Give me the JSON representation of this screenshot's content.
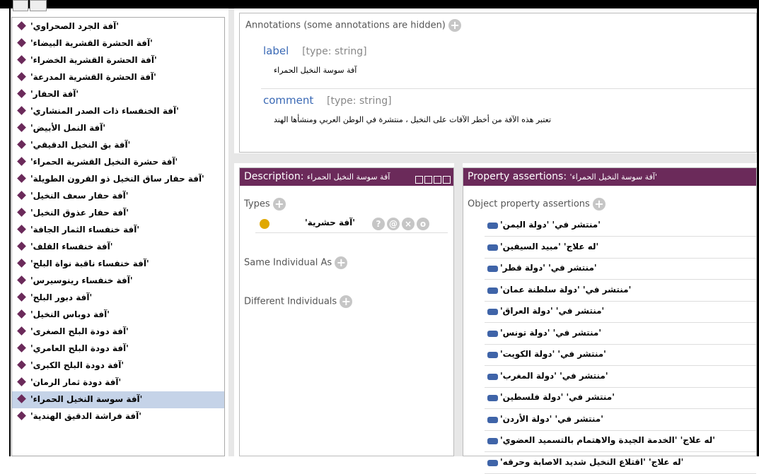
{
  "tree": {
    "items": [
      {
        "label": "'آفة الجرد الصحراوي'"
      },
      {
        "label": "'آفة الحشرة القشرية البيضاء'"
      },
      {
        "label": "'آفة الحشرة القشرية الخضراء'"
      },
      {
        "label": "'آفة الحشرة القشرية المدرعة'"
      },
      {
        "label": "'آفة الحفار'"
      },
      {
        "label": "'آفة الخنفساء ذات الصدر المنشاري'"
      },
      {
        "label": "'آفة النمل الأبيض'"
      },
      {
        "label": "'آفة بق النخيل الدقيقي'"
      },
      {
        "label": "'آفة حشرة النخيل القشرية الحمراء'"
      },
      {
        "label": "'آفة حفار ساق النخيل ذو القرون الطويلة'"
      },
      {
        "label": "'آفة حفار سعف النخيل'"
      },
      {
        "label": "'آفة حفار عذوق النخيل'"
      },
      {
        "label": "'آفة خنفساء الثمار الجافة'"
      },
      {
        "label": "'آفة خنفساء القلف'"
      },
      {
        "label": "'آفة خنفساء ناقبة نواة البلح'"
      },
      {
        "label": "'آفة خنفساء رينوسيرس'"
      },
      {
        "label": "'آفة دبور البلح'"
      },
      {
        "label": "'آفة دوباس النخيل'"
      },
      {
        "label": "'آفة دودة البلح الصغرى'"
      },
      {
        "label": "'آفة دودة البلح العامري'"
      },
      {
        "label": "'آفة دودة البلح الكبرى'"
      },
      {
        "label": "'آفة دودة ثمار الرمان'"
      },
      {
        "label": "'آفة سوسة النخيل الحمراء'",
        "selected": true
      },
      {
        "label": "'آفة فراشة الدقيق الهندية'"
      }
    ]
  },
  "annotations": {
    "title": "Annotations (some annotations are hidden)",
    "label_key": "label",
    "label_type": "[type: string]",
    "label_value": "آفة سوسة النخيل الحمراء",
    "comment_key": "comment",
    "comment_type": "[type: string]",
    "comment_value": "تعتبر هذه الآفة من أخطر الآفات على النخيل ، منتشرة في الوطن العربي ومنشأها الهند"
  },
  "description": {
    "header_prefix": "Description: ",
    "header_name": "آفة سوسة النخيل الحمراء",
    "types_title": "Types",
    "type_value": "'آفة حشرية'",
    "same_title": "Same Individual As",
    "different_title": "Different Individuals",
    "actions": [
      "?",
      "@",
      "×",
      "o"
    ]
  },
  "properties": {
    "header_prefix": "Property assertions: ",
    "header_name": "'آفة سوسة النخيل الحمراء'",
    "obj_title": "Object property assertions",
    "rows": [
      "'منتشر في' 'دولة اليمن'",
      "'له علاج' 'مبيد السيفين'",
      "'منتشر في' 'دولة قطر'",
      "'منتشر في' 'دولة سلطنة عمان'",
      "'منتشر في' 'دولة العراق'",
      "'منتشر في' 'دولة تونس'",
      "'منتشر في' 'دولة الكويت'",
      "'منتشر في' 'دولة المغرب'",
      "'منتشر في' 'دولة فلسطين'",
      "'منتشر في' 'دولة الأردن'",
      "'له علاج' 'الخدمة الجيدة والاهتمام بالتسميد العضوي'",
      "'له علاج' 'اقتلاع النخيل شديد الاصابة وحرقه'"
    ]
  },
  "colors": {
    "header_bg": "#6b2a5a",
    "individual_diamond": "#6b2a5a",
    "selected_row": "#c5d3e8",
    "key_blue": "#3a69b5",
    "class_dot": "#e0a800",
    "property_chip": "#3f64a8"
  }
}
